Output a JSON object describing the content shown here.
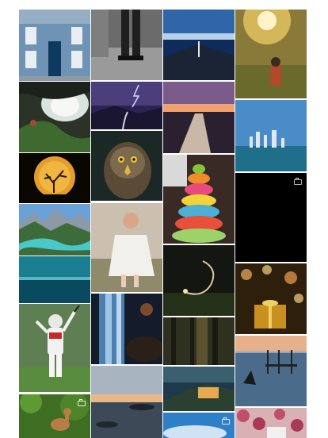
{
  "gallery": {
    "item_count": 24
  }
}
